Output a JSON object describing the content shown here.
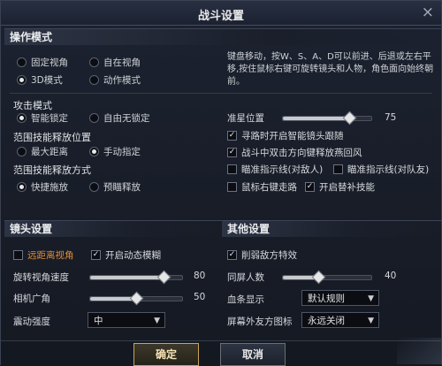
{
  "window": {
    "title": "战斗设置",
    "close_glyph": "×"
  },
  "control_mode": {
    "header": "操作模式",
    "options": [
      {
        "label": "固定视角",
        "selected": false
      },
      {
        "label": "自在视角",
        "selected": false
      },
      {
        "label": "3D模式",
        "selected": true
      },
      {
        "label": "动作模式",
        "selected": false
      }
    ],
    "description": "键盘移动，按W、S、A、D可以前进、后退或左右平移,按住鼠标右键可旋转镜头和人物，角色面向始终朝前。"
  },
  "attack_mode": {
    "header": "攻击模式",
    "options": [
      {
        "label": "智能锁定",
        "selected": true
      },
      {
        "label": "自由无锁定",
        "selected": false
      }
    ]
  },
  "range_skill_position": {
    "header": "范围技能释放位置",
    "options": [
      {
        "label": "最大距离",
        "selected": false
      },
      {
        "label": "手动指定",
        "selected": true
      }
    ]
  },
  "range_skill_method": {
    "header": "范围技能释放方式",
    "options": [
      {
        "label": "快捷施放",
        "selected": true
      },
      {
        "label": "预瞄释放",
        "selected": false
      }
    ]
  },
  "crosshair": {
    "label": "准星位置",
    "value": "75",
    "fraction": 0.75
  },
  "combat_checks": [
    {
      "label": "寻路时开启智能镜头跟随",
      "checked": true
    },
    {
      "label": "战斗中双击方向键释放燕回风",
      "checked": true
    },
    {
      "label": "瞄准指示线(对敌人)",
      "checked": false
    },
    {
      "label": "瞄准指示线(对队友)",
      "checked": false
    },
    {
      "label": "鼠标右键走路",
      "checked": false
    },
    {
      "label": "开启替补技能",
      "checked": true
    }
  ],
  "camera": {
    "header": "镜头设置",
    "far_view": {
      "label": "远距离视角",
      "checked": false
    },
    "motion_blur": {
      "label": "开启动态模糊",
      "checked": true
    },
    "rotate_speed": {
      "label": "旋转视角速度",
      "value": "80",
      "fraction": 0.8
    },
    "fov": {
      "label": "相机广角",
      "value": "50",
      "fraction": 0.5
    },
    "shake": {
      "label": "震动强度",
      "value": "中"
    }
  },
  "other": {
    "header": "其他设置",
    "weaken_enemy": {
      "label": "削弱敌方特效",
      "checked": true
    },
    "same_screen": {
      "label": "同屏人数",
      "value": "40",
      "fraction": 0.4
    },
    "blood_display": {
      "label": "血条显示",
      "value": "默认规则"
    },
    "offscreen_icon": {
      "label": "屏幕外友方图标",
      "value": "永远关闭"
    }
  },
  "buttons": {
    "confirm": "确定",
    "cancel": "取消"
  }
}
